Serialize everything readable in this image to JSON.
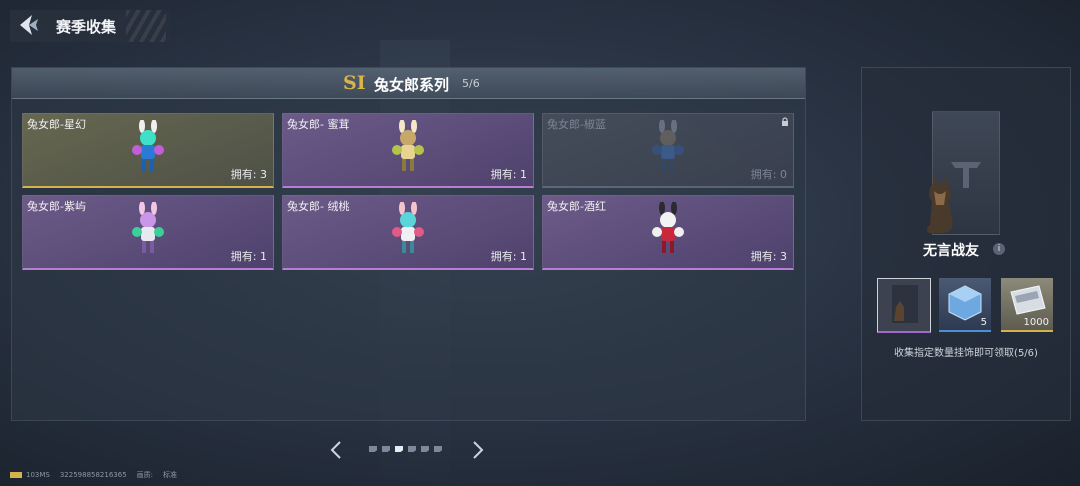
{
  "header": {
    "title": "赛季收集"
  },
  "series": {
    "mark": "SI",
    "title": "兔女郎系列",
    "count": "5/6"
  },
  "cards": [
    {
      "name": "兔女郎-星幻",
      "owned": "拥有: 3",
      "style": "gold"
    },
    {
      "name": "兔女郎- 蜜茸",
      "owned": "拥有: 1",
      "style": "purple"
    },
    {
      "name": "兔女郎-椒蓝",
      "owned": "拥有: 0",
      "style": "locked"
    },
    {
      "name": "兔女郎-紫屿",
      "owned": "拥有: 1",
      "style": "purple"
    },
    {
      "name": "兔女郎- 绒桃",
      "owned": "拥有: 1",
      "style": "purple"
    },
    {
      "name": "兔女郎-酒红",
      "owned": "拥有: 3",
      "style": "purple"
    }
  ],
  "pagination": {
    "pages": 6,
    "current": 3
  },
  "reward": {
    "name": "无言战友",
    "info": "i",
    "slots": [
      {
        "icon": "dog-portrait-icon",
        "qty": ""
      },
      {
        "icon": "blue-crate-icon",
        "qty": "5"
      },
      {
        "icon": "ticket-icon",
        "qty": "1000"
      }
    ],
    "note": "收集指定数量挂饰即可领取(5/6)"
  },
  "footer": {
    "ping": "103MS",
    "uid": "322598858216365",
    "quality_label": "画质:",
    "quality": "标准"
  },
  "colors": {
    "gold": "#d6b24a",
    "purple": "#b77ed6",
    "blue": "#4a90d9"
  }
}
